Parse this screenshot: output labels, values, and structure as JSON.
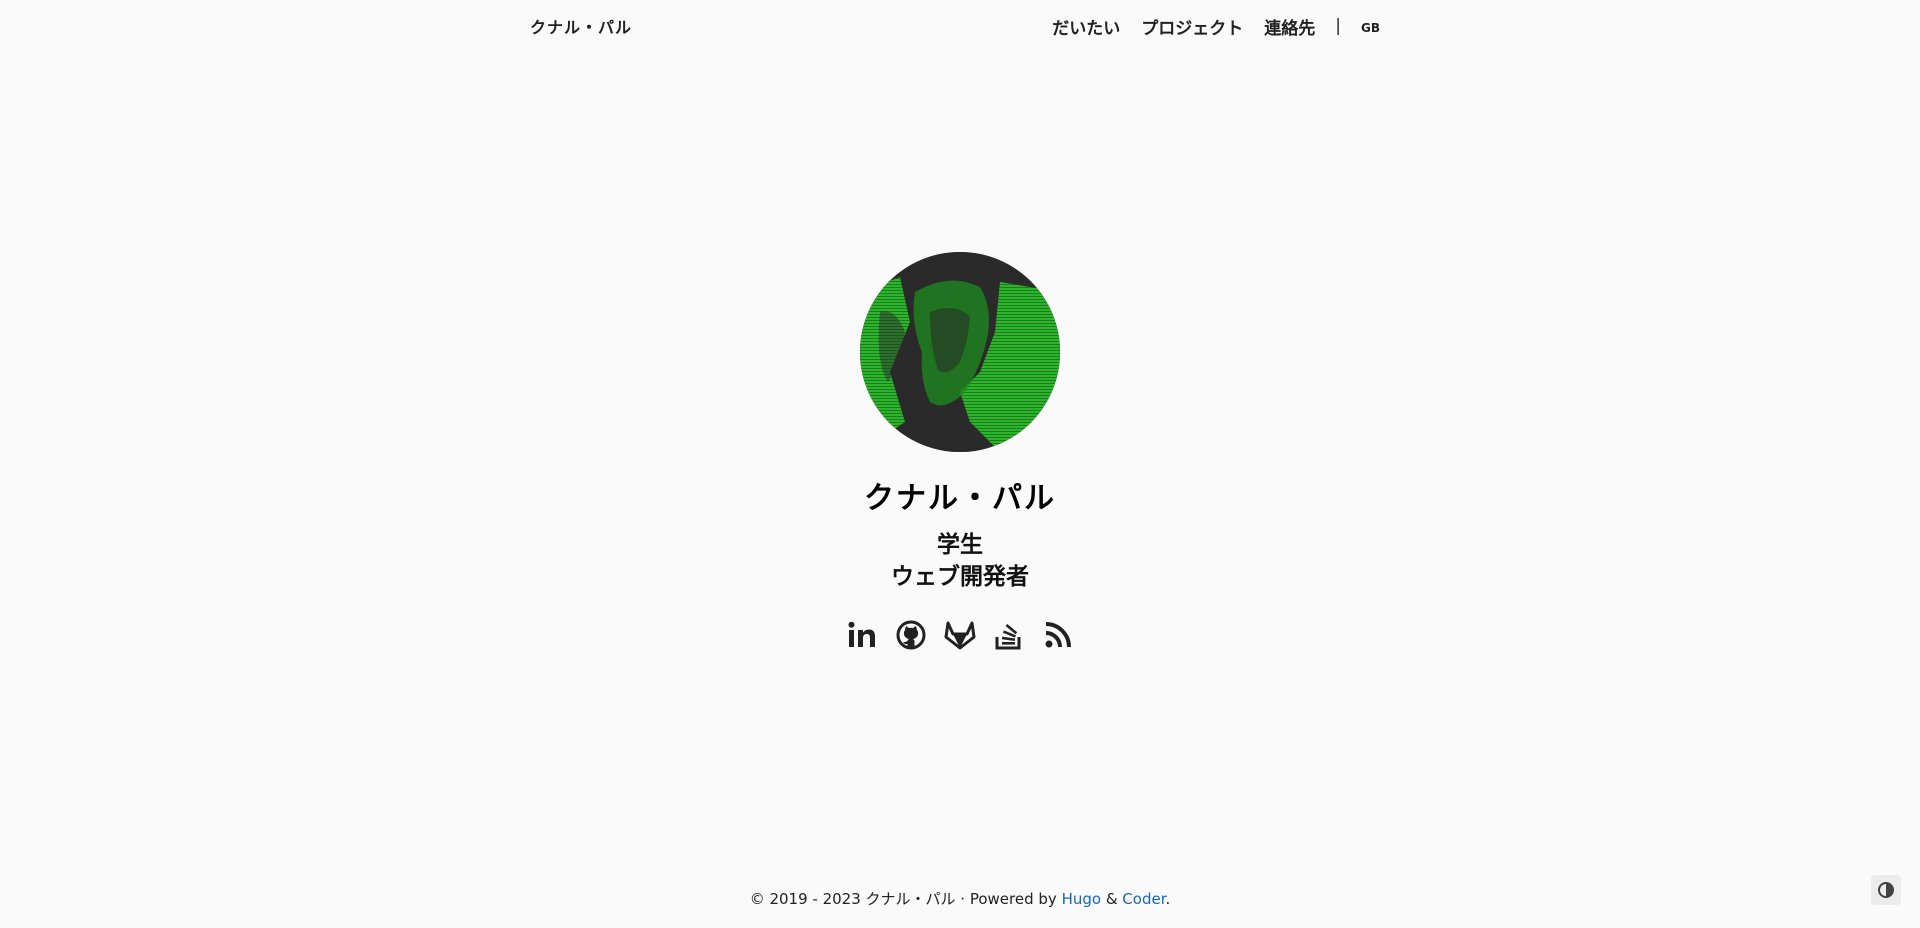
{
  "header": {
    "brand": "クナル・パル",
    "nav": [
      "だいたい",
      "プロジェクト",
      "連絡先"
    ],
    "separator": "|",
    "language": "GB"
  },
  "profile": {
    "name": "クナル・パル",
    "tagline_line1": "学生",
    "tagline_line2": "ウェブ開発者",
    "avatar_colors": {
      "accent": "#2bb52b",
      "dark": "#2a2a2a"
    }
  },
  "social": [
    {
      "icon": "linkedin-icon"
    },
    {
      "icon": "github-icon"
    },
    {
      "icon": "gitlab-icon"
    },
    {
      "icon": "stackoverflow-icon"
    },
    {
      "icon": "rss-icon"
    }
  ],
  "footer": {
    "copyright": "© 2019 - 2023 クナル・パル · Powered by ",
    "hugo": "Hugo",
    "amp": " & ",
    "coder": "Coder",
    "end": ".",
    "link_color": "#1565c0"
  },
  "theme_toggle": {
    "icon": "contrast-icon"
  }
}
